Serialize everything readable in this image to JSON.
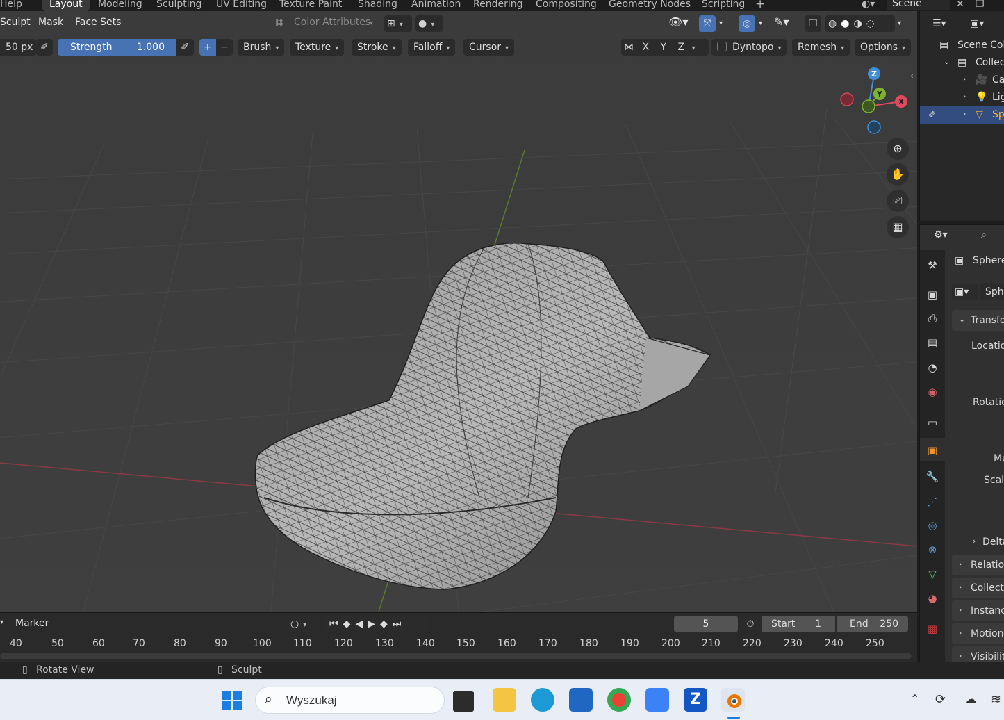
{
  "topbar": {
    "help": "Help",
    "workspaces": [
      "Layout",
      "Modeling",
      "Sculpting",
      "UV Editing",
      "Texture Paint",
      "Shading",
      "Animation",
      "Rendering",
      "Compositing",
      "Geometry Nodes",
      "Scripting"
    ],
    "active_workspace": "Layout",
    "add_label": "+",
    "scene": "Scene"
  },
  "viewport": {
    "mode_menus": [
      "Sculpt",
      "Mask",
      "Face Sets"
    ],
    "color_attributes": "Color Attributes",
    "radius": "50 px",
    "strength_label": "Strength",
    "strength_value": "1.000",
    "brush_menus": [
      "Brush",
      "Texture",
      "Stroke",
      "Falloff",
      "Cursor"
    ],
    "axes": [
      "X",
      "Y",
      "Z"
    ],
    "dyntopo": "Dyntopo",
    "remesh": "Remesh",
    "options": "Options",
    "gizmo": {
      "x": "X",
      "y": "Y",
      "z": "Z"
    },
    "colors": {
      "x_axis": "#e04a5e",
      "y_axis": "#7fb233",
      "z_axis": "#3f8fd8",
      "accent": "#4772b3"
    }
  },
  "timeline": {
    "marker": "Marker",
    "current_frame": "5",
    "start_label": "Start",
    "start_value": "1",
    "end_label": "End",
    "end_value": "250",
    "ticks": [
      "40",
      "50",
      "60",
      "70",
      "80",
      "90",
      "100",
      "110",
      "120",
      "130",
      "140",
      "150",
      "160",
      "170",
      "180",
      "190",
      "200",
      "210",
      "220",
      "230",
      "240",
      "250"
    ]
  },
  "statusbar": {
    "left": "Rotate View",
    "middle": "Sculpt"
  },
  "outliner": {
    "items": [
      "Scene Col",
      "Collec",
      "Ca",
      "Lig",
      "Sp"
    ]
  },
  "properties": {
    "object_name": "Sphere",
    "data_name": "Sphe",
    "transform": "Transfo",
    "location": "Locatio",
    "rotation": "Rotatio",
    "mode": "Mo",
    "scale": "Scal",
    "delta": "Delta",
    "sections": [
      "Relation",
      "Collecti",
      "Instanc",
      "Motion",
      "Visibility"
    ]
  },
  "taskbar": {
    "search_placeholder": "Wyszukaj"
  }
}
